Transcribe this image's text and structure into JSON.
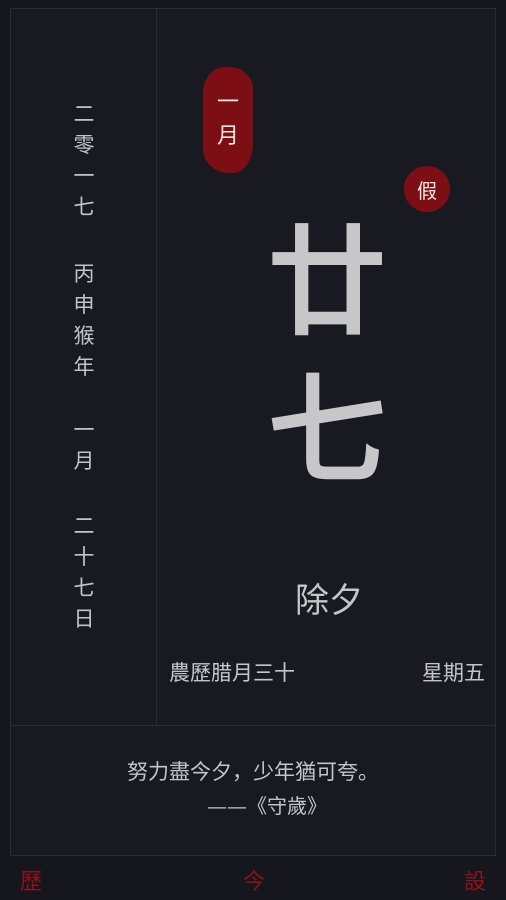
{
  "left_column": {
    "year": [
      "二",
      "零",
      "一",
      "七"
    ],
    "ganzhi_year": [
      "丙",
      "申",
      "猴",
      "年"
    ],
    "month": [
      "一",
      "月"
    ],
    "day": [
      "二",
      "十",
      "七",
      "日"
    ]
  },
  "month_seal": [
    "一",
    "月"
  ],
  "holiday_badge": "假",
  "day_big": [
    "廿",
    "七"
  ],
  "festival": "除夕",
  "lunar_date": "農歷腊月三十",
  "weekday": "星期五",
  "quote": {
    "line": "努力盡今夕，少年猶可夸。",
    "source": "——《守歲》"
  },
  "nav": {
    "history": "歷",
    "today": "今",
    "settings": "設"
  },
  "colors": {
    "background": "#16171d",
    "seal_red": "#7d0f14",
    "nav_red": "#8e1218",
    "text": "#c6c6c9"
  }
}
